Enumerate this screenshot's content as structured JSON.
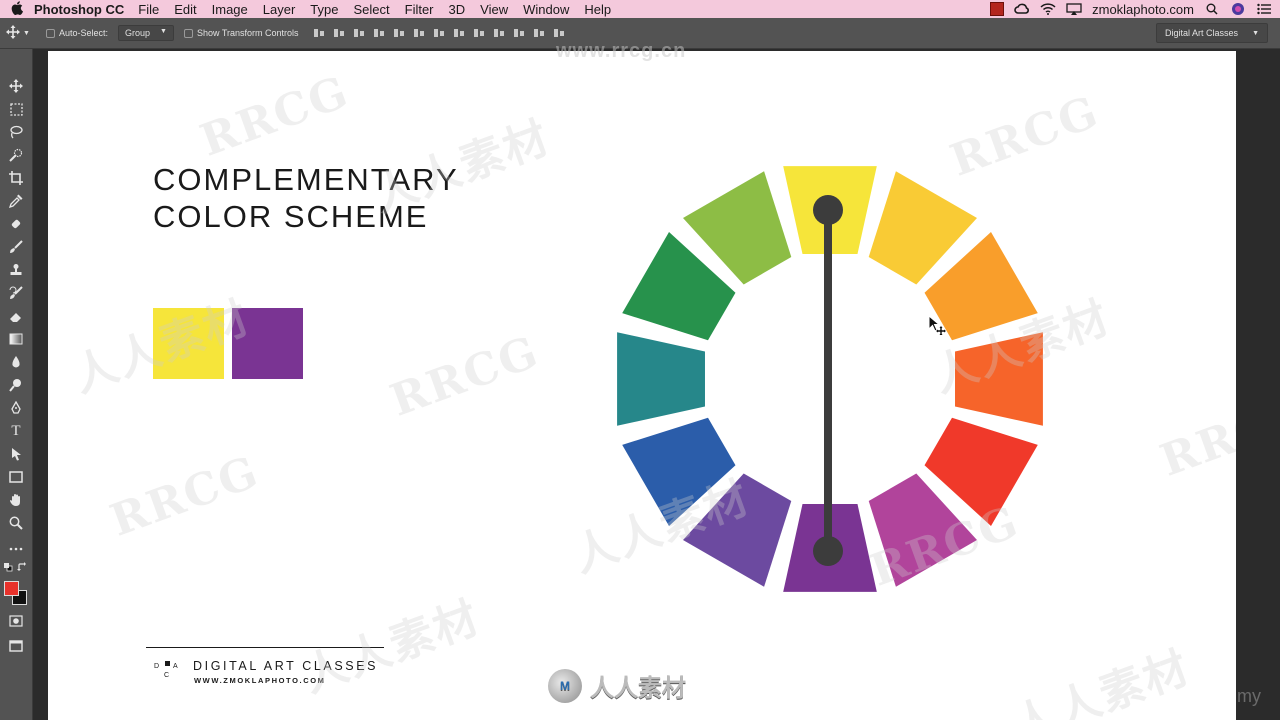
{
  "menubar": {
    "app_name": "Photoshop CC",
    "menus": [
      "File",
      "Edit",
      "Image",
      "Layer",
      "Type",
      "Select",
      "Filter",
      "3D",
      "View",
      "Window",
      "Help"
    ],
    "site": "zmoklaphoto.com"
  },
  "options_bar": {
    "auto_select_label": "Auto-Select:",
    "auto_select_value": "Group",
    "show_transform_label": "Show Transform Controls",
    "workspace": "Digital Art Classes"
  },
  "tools": {
    "foreground_color": "#e8322b",
    "background_color": "#111111"
  },
  "document": {
    "title_line1": "COMPLEMENTARY",
    "title_line2": "COLOR SCHEME",
    "swatches": [
      "#f6e53a",
      "#7a3493"
    ],
    "wheel_segment_colors": [
      "#f6e53a",
      "#f9cb35",
      "#f99e2b",
      "#f6642a",
      "#f0392a",
      "#b1449b",
      "#7a3493",
      "#6c4aa0",
      "#2b5daa",
      "#26878a",
      "#27924c",
      "#8dbd45"
    ],
    "brand_name": "DIGITAL ART CLASSES",
    "brand_url": "WWW.ZMOKLAPHOTO.COM",
    "logo_letters": [
      "D",
      "A",
      "C"
    ]
  },
  "watermark": {
    "center_url": "www.rrcg.cn",
    "bottom_text": "人人素材",
    "bottom_logo": "M",
    "corner": "my"
  }
}
